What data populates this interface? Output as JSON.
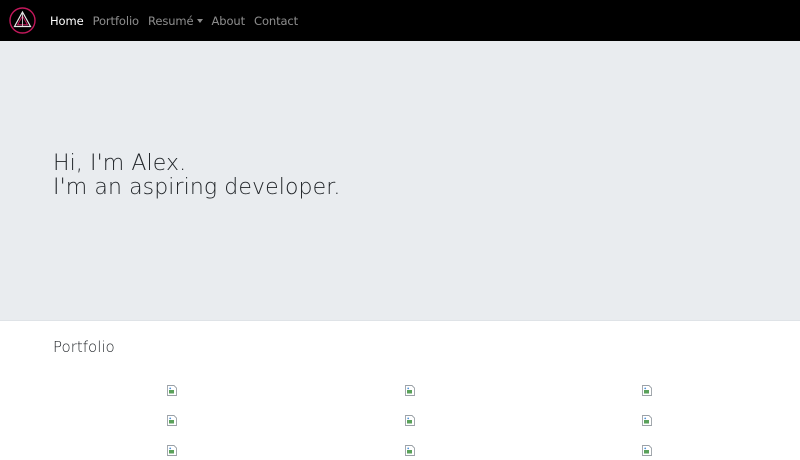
{
  "nav": {
    "brand_icon": "triangle-logo-icon",
    "links": [
      {
        "label": "Home",
        "active": true
      },
      {
        "label": "Portfolio",
        "active": false
      },
      {
        "label": "Resumé",
        "active": false,
        "dropdown": true
      },
      {
        "label": "About",
        "active": false
      },
      {
        "label": "Contact",
        "active": false
      }
    ]
  },
  "hero": {
    "line1": "Hi, I'm Alex.",
    "line2": "I'm an aspiring developer."
  },
  "portfolio": {
    "title": "Portfolio",
    "thumbnail_icon": "broken-image-icon",
    "rows": 3,
    "cols": 3
  },
  "colors": {
    "navbar_bg": "#000000",
    "hero_bg": "#e9ecef",
    "logo_accent": "#c2185b"
  }
}
